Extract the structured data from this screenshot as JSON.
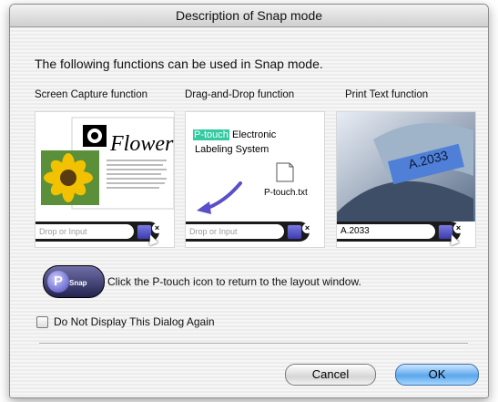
{
  "window": {
    "title": "Description of Snap mode"
  },
  "intro": "The following functions can be used in Snap mode.",
  "panels": [
    {
      "label": "Screen Capture function",
      "doc_heading": "Flower",
      "input_text": "Drop or Input"
    },
    {
      "label": "Drag-and-Drop function",
      "highlight_word": "P-touch",
      "line1_rest": " Electronic",
      "line2": "Labeling System",
      "file_name": "P-touch.txt",
      "input_text": "Drop or Input"
    },
    {
      "label": "Print Text function",
      "tape_text": "A.2033",
      "input_text": "A.2033"
    }
  ],
  "info": {
    "icon_text": "Snap",
    "text": "Click the P-touch icon to return to the layout window."
  },
  "checkbox": {
    "label": "Do Not Display This Dialog Again",
    "checked": false
  },
  "buttons": {
    "cancel": "Cancel",
    "ok": "OK"
  },
  "colors": {
    "ok_button": "#5aa7ec",
    "snap_icon": "#3c3cb0",
    "highlight": "#34c9a0"
  },
  "icons": {
    "file": "document-icon",
    "arrow": "drag-arrow-icon",
    "snap": "ptouch-snap-icon"
  }
}
